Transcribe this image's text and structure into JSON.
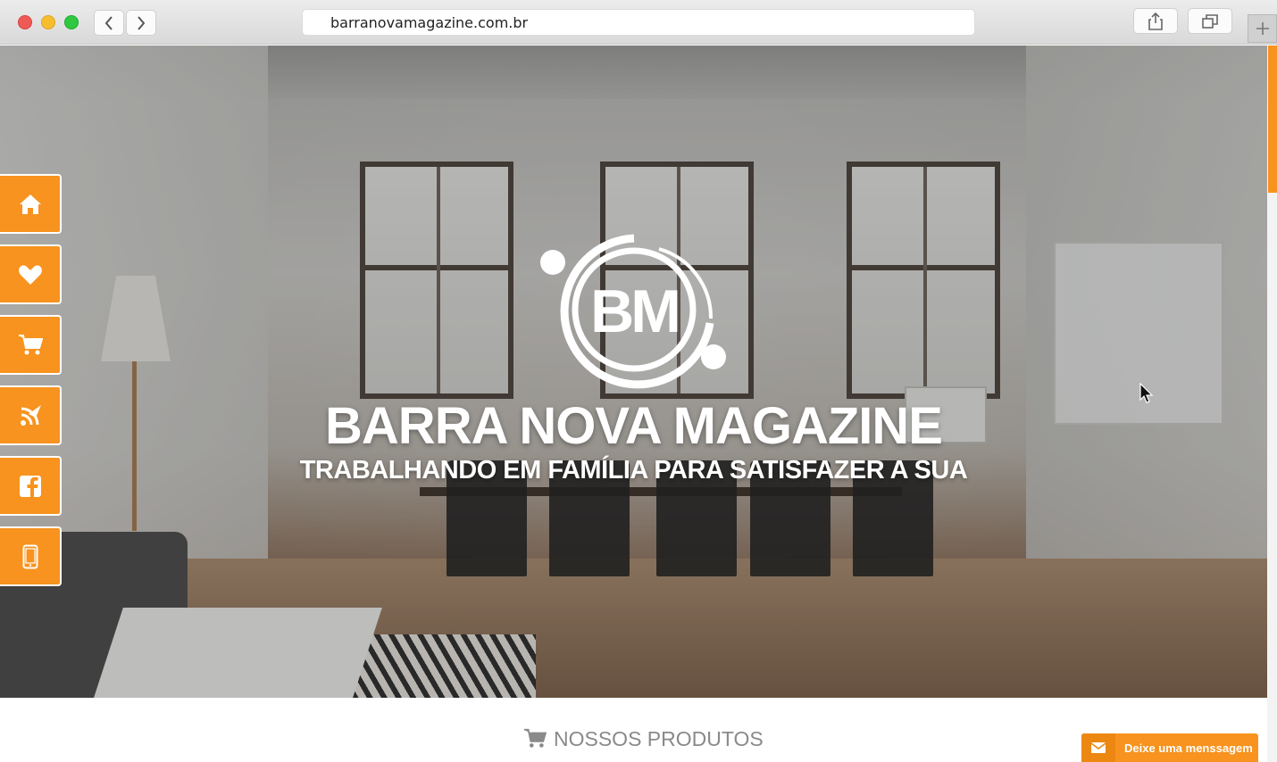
{
  "browser": {
    "url": "barranovamagazine.com.br"
  },
  "hero": {
    "logo_text": "BM",
    "title": "BARRA NOVA MAGAZINE",
    "tagline": "TRABALHANDO EM FAMÍLIA PARA SATISFAZER A SUA"
  },
  "sidenav": {
    "items": [
      {
        "icon": "home-icon"
      },
      {
        "icon": "heart-icon"
      },
      {
        "icon": "cart-icon"
      },
      {
        "icon": "feed-icon"
      },
      {
        "icon": "facebook-icon"
      },
      {
        "icon": "mobile-icon"
      }
    ]
  },
  "section": {
    "title": "NOSSOS PRODUTOS"
  },
  "message_widget": {
    "label": "Deixe uma menssagem"
  },
  "colors": {
    "accent": "#f7931e",
    "text_muted": "#8a8a8a"
  }
}
